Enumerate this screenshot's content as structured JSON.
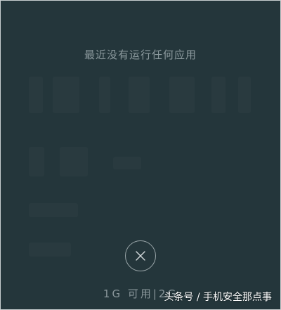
{
  "recents": {
    "empty_message": "最近没有运行任何应用"
  },
  "controls": {
    "clear_all_icon": "close-icon"
  },
  "memory": {
    "status": "1G 可用|2G"
  },
  "watermark": {
    "text": "头条号 / 手机安全那点事"
  },
  "colors": {
    "background": "#24363b",
    "text_muted": "#8c9a9e",
    "watermark": "#ffffff"
  }
}
